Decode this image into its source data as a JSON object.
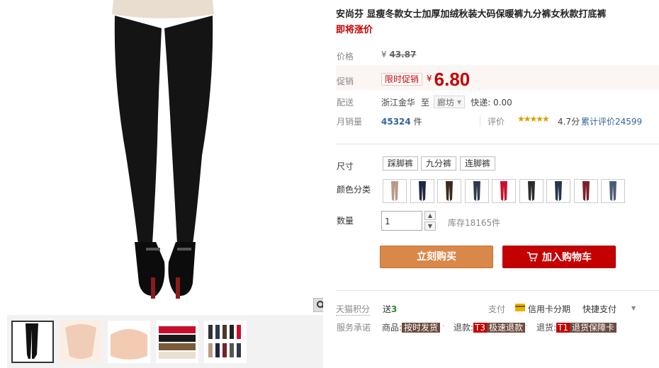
{
  "product": {
    "title": "安尚芬 显瘦冬款女士加厚加绒秋装大码保暖裤九分裤女秋款打底裤",
    "subtitle": "即将涨价"
  },
  "price": {
    "label": "价格",
    "currency": "¥",
    "original": "43.87"
  },
  "promo": {
    "label": "促销",
    "tag": "限时促销",
    "currency": "¥",
    "value": "6.80"
  },
  "shipping": {
    "label": "配送",
    "from": "浙江金华",
    "to_word": "至",
    "destination": "廊坊",
    "express": "快递: 0.00"
  },
  "sales": {
    "label": "月销量",
    "count": "45324",
    "unit": "件",
    "rating_label": "评价",
    "stars": "★★★★★",
    "score": "4.7分",
    "cumulative": "累计评价24599"
  },
  "size": {
    "label": "尺寸",
    "options": [
      "踩脚裤",
      "九分裤",
      "连脚裤"
    ]
  },
  "color": {
    "label": "颜色分类",
    "swatch_colors": [
      "#b89a86",
      "#1f2640",
      "#3a2b1e",
      "#2e3a4c",
      "#c8102e",
      "#2c2c2c",
      "#24364f",
      "#7a1f2b",
      "#4a5c78"
    ]
  },
  "quantity": {
    "label": "数量",
    "value": "1",
    "stock": "库存18165件"
  },
  "buttons": {
    "buy": "立刻购买",
    "cart": "加入购物车"
  },
  "footer": {
    "points_label": "天猫积分",
    "points_prefix": "送",
    "points_value": "3",
    "pay_label": "支付",
    "credit": "信用卡分期",
    "quickpay": "快捷支付",
    "service_label": "服务承诺",
    "service1_prefix": "商品:",
    "service1_tag": "按时发货",
    "service2_prefix": "退款:",
    "service2_t": "T3",
    "service2_tag": "极速退款",
    "service3_prefix": "退货:",
    "service3_t": "T1",
    "service3_tag": "退货保障卡"
  },
  "colors": {
    "accent_red": "#c40000",
    "buy_orange": "#d9884a"
  }
}
